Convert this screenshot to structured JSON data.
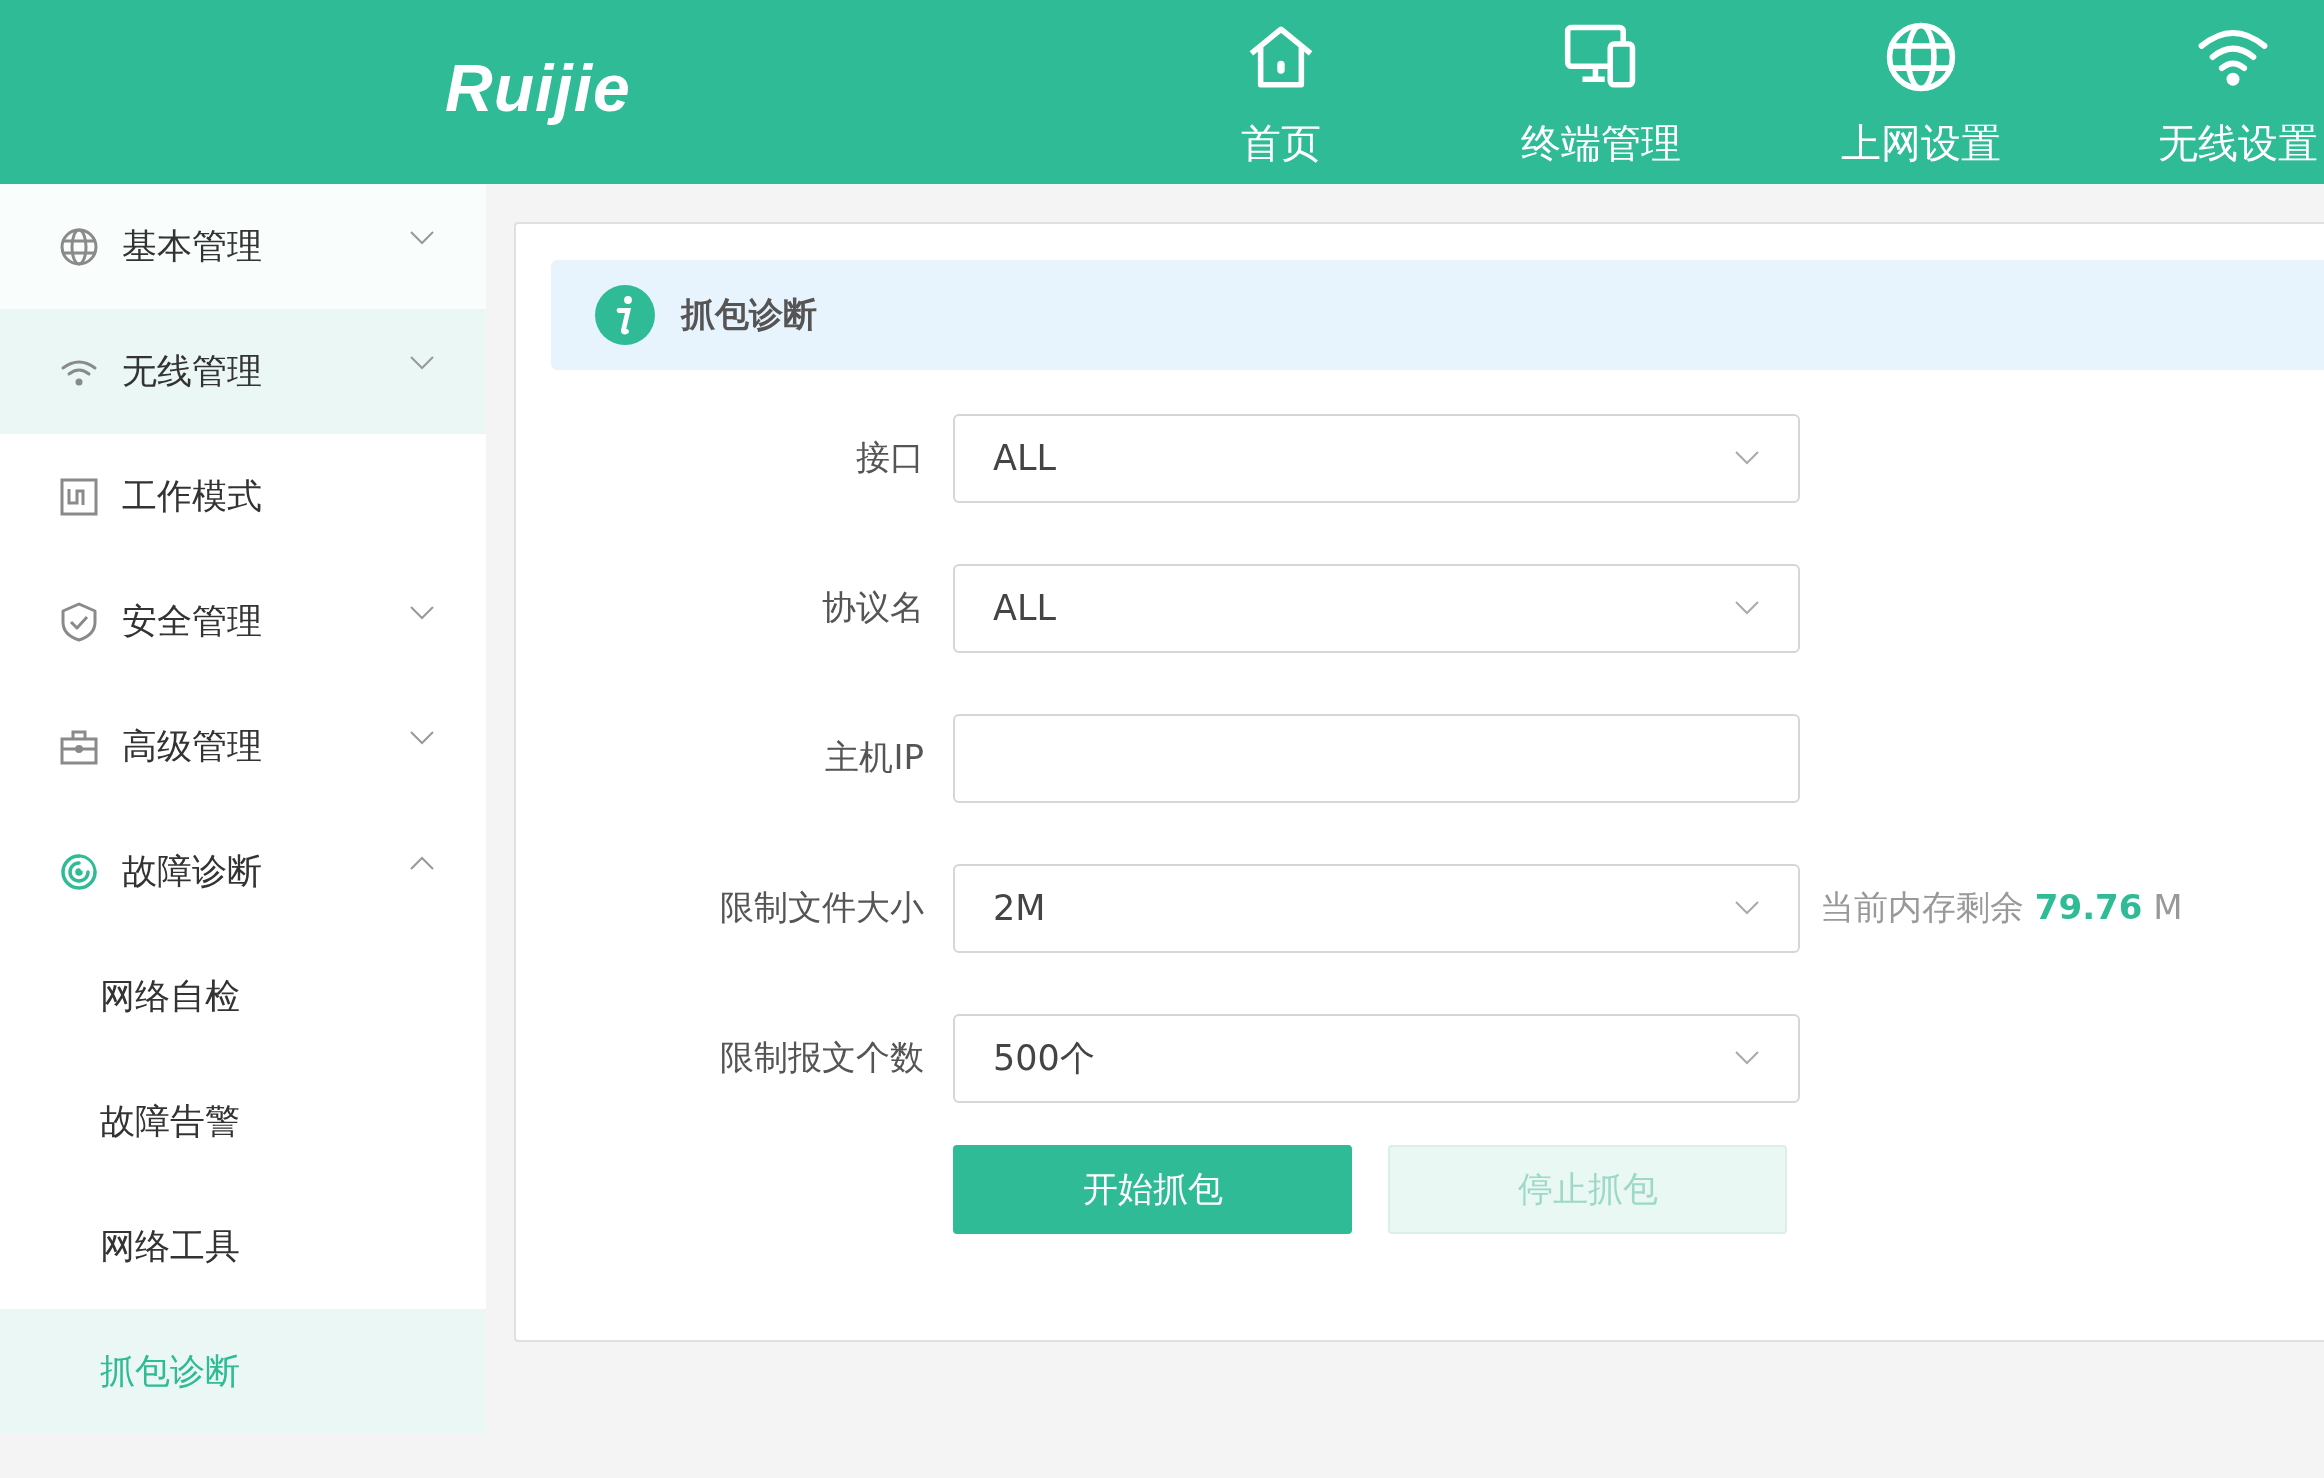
{
  "header": {
    "logo": "Ruijie",
    "nav": [
      {
        "label": "首页"
      },
      {
        "label": "终端管理"
      },
      {
        "label": "上网设置"
      },
      {
        "label": "无线设置"
      }
    ]
  },
  "sidebar": {
    "items": [
      {
        "label": "基本管理",
        "expandable": true,
        "expanded": false,
        "hovered": false
      },
      {
        "label": "无线管理",
        "expandable": true,
        "expanded": false,
        "hovered": true
      },
      {
        "label": "工作模式",
        "expandable": false,
        "expanded": false,
        "hovered": false
      },
      {
        "label": "安全管理",
        "expandable": true,
        "expanded": false,
        "hovered": false
      },
      {
        "label": "高级管理",
        "expandable": true,
        "expanded": false,
        "hovered": false
      },
      {
        "label": "故障诊断",
        "expandable": true,
        "expanded": true,
        "hovered": false,
        "children": [
          {
            "label": "网络自检",
            "selected": false
          },
          {
            "label": "故障告警",
            "selected": false
          },
          {
            "label": "网络工具",
            "selected": false
          },
          {
            "label": "抓包诊断",
            "selected": true
          }
        ]
      }
    ]
  },
  "panel": {
    "title": "抓包诊断",
    "fields": [
      {
        "kind": "select",
        "label": "接口",
        "value": "ALL"
      },
      {
        "kind": "select",
        "label": "协议名",
        "value": "ALL"
      },
      {
        "kind": "text",
        "label": "主机IP"
      },
      {
        "kind": "select",
        "label": "限制文件大小",
        "value": "2M",
        "note": {
          "prefix": "当前内存剩余",
          "amount": "79.76",
          "unit": "M"
        }
      },
      {
        "kind": "select",
        "label": "限制报文个数",
        "value": "500个"
      }
    ],
    "buttons": [
      {
        "label": "开始抓包",
        "disabled": false
      },
      {
        "label": "停止抓包",
        "disabled": true
      }
    ]
  }
}
